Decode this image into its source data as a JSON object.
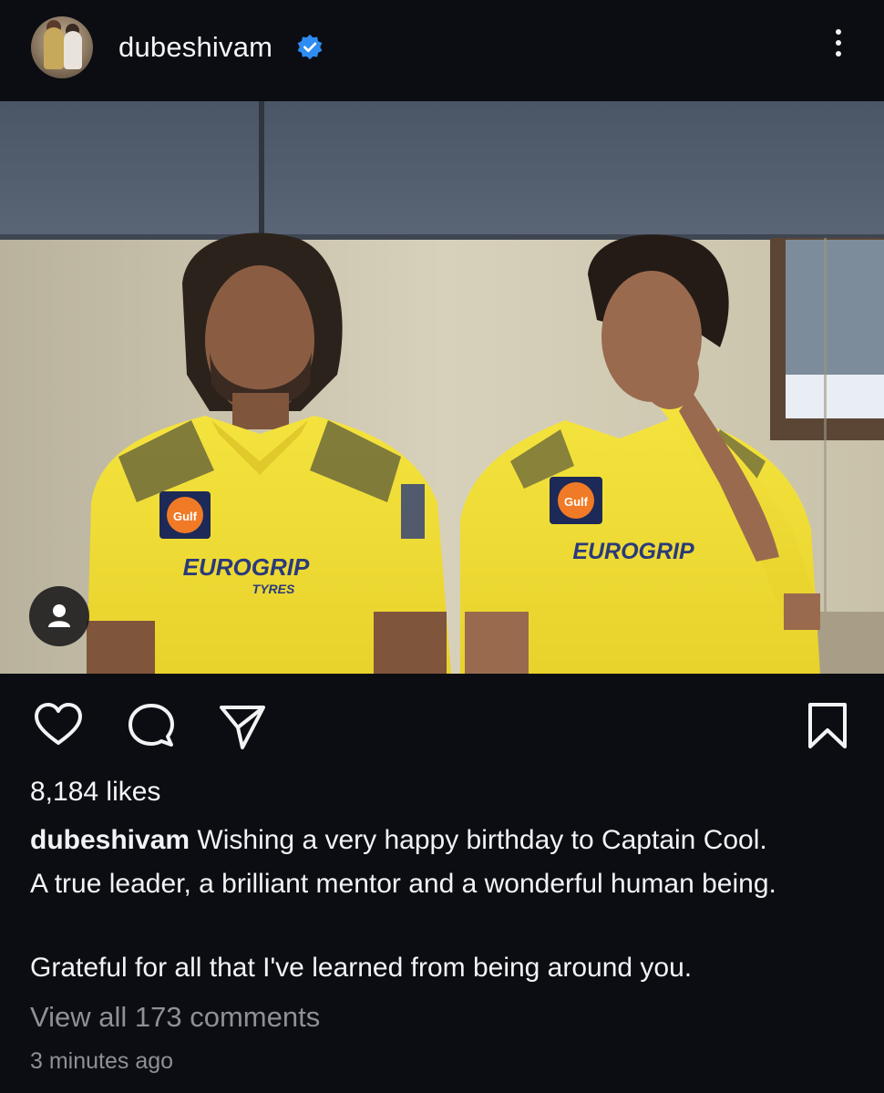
{
  "post": {
    "username": "dubeshivam",
    "verified": true,
    "likes": "8,184 likes",
    "caption_user": "dubeshivam",
    "caption_line1": "Wishing a very happy birthday to Captain Cool.",
    "caption_line2": "A true leader, a brilliant mentor and a wonderful human being.",
    "caption_line3": "Grateful for all that I've learned from being around you.",
    "view_comments": "View all 173 comments",
    "timestamp": "3 minutes ago"
  },
  "photo_text": {
    "sponsor_left": "Gulf",
    "sponsor_right": "Gulf",
    "chest_left": "EUROGRIP",
    "chest_right": "EUROGRIP",
    "chest_sub": "TYRES"
  },
  "icons": {
    "avatar": "profile-avatar",
    "verified": "verified-badge-icon",
    "more": "more-options-icon",
    "tagged": "tagged-user-icon",
    "like": "heart-icon",
    "comment": "comment-icon",
    "share": "share-icon",
    "save": "bookmark-icon"
  },
  "colors": {
    "background": "#0b0d12",
    "verified_blue": "#2f8cf2",
    "jersey_yellow": "#f2df3a",
    "muted_text": "#8e9096"
  }
}
